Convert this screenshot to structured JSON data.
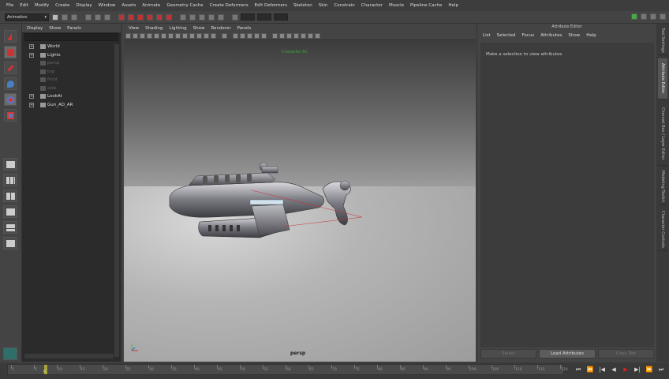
{
  "menubar": [
    "File",
    "Edit",
    "Modify",
    "Create",
    "Display",
    "Window",
    "Assets",
    "Animate",
    "Geometry Cache",
    "Create Deformers",
    "Edit Deformers",
    "Skeleton",
    "Skin",
    "Constrain",
    "Character",
    "Muscle",
    "Pipeline Cache",
    "Help"
  ],
  "shelf": {
    "mode": "Animation"
  },
  "outliner": {
    "menu": [
      "Display",
      "Show",
      "Panels"
    ],
    "items": [
      {
        "label": "World",
        "expandable": true,
        "dim": false
      },
      {
        "label": "Lights",
        "expandable": true,
        "dim": false
      },
      {
        "label": "persp",
        "expandable": false,
        "dim": true
      },
      {
        "label": "top",
        "expandable": false,
        "dim": true
      },
      {
        "label": "front",
        "expandable": false,
        "dim": true
      },
      {
        "label": "side",
        "expandable": false,
        "dim": true
      },
      {
        "label": "LookAt",
        "expandable": true,
        "dim": false
      },
      {
        "label": "Gun_AD_AR",
        "expandable": true,
        "dim": false
      }
    ]
  },
  "viewport": {
    "menu": [
      "View",
      "Shading",
      "Lighting",
      "Show",
      "Renderer",
      "Panels"
    ],
    "hud_top": "Character AC",
    "camera": "persp"
  },
  "attribute_editor": {
    "title": "Attribute Editor",
    "menu": [
      "List",
      "Selected",
      "Focus",
      "Attributes",
      "Show",
      "Help"
    ],
    "message": "Make a selection to view attributes",
    "buttons": [
      {
        "label": "Select",
        "enabled": false
      },
      {
        "label": "Load Attributes",
        "enabled": true
      },
      {
        "label": "Copy Tab",
        "enabled": false
      }
    ]
  },
  "side_tabs": [
    "Tool Settings",
    "Attribute Editor",
    "Channel Box / Layer Editor",
    "Modeling Toolkit",
    "Character Controls"
  ],
  "time_slider": {
    "ticks": [
      "1",
      "5",
      "10",
      "15",
      "20",
      "25",
      "30",
      "35",
      "40",
      "45",
      "50",
      "55",
      "60",
      "65",
      "70",
      "75",
      "80",
      "85",
      "90",
      "95",
      "100",
      "105",
      "110",
      "115",
      "120"
    ],
    "current_frame": "6",
    "controls": [
      "⏮",
      "⏪",
      "|◀",
      "◀",
      "▶",
      "▶|",
      "⏩",
      "⏭"
    ]
  },
  "colors": {
    "hud": "#39a83b",
    "playhead": "#cccc33",
    "stop": "#dd2222"
  }
}
